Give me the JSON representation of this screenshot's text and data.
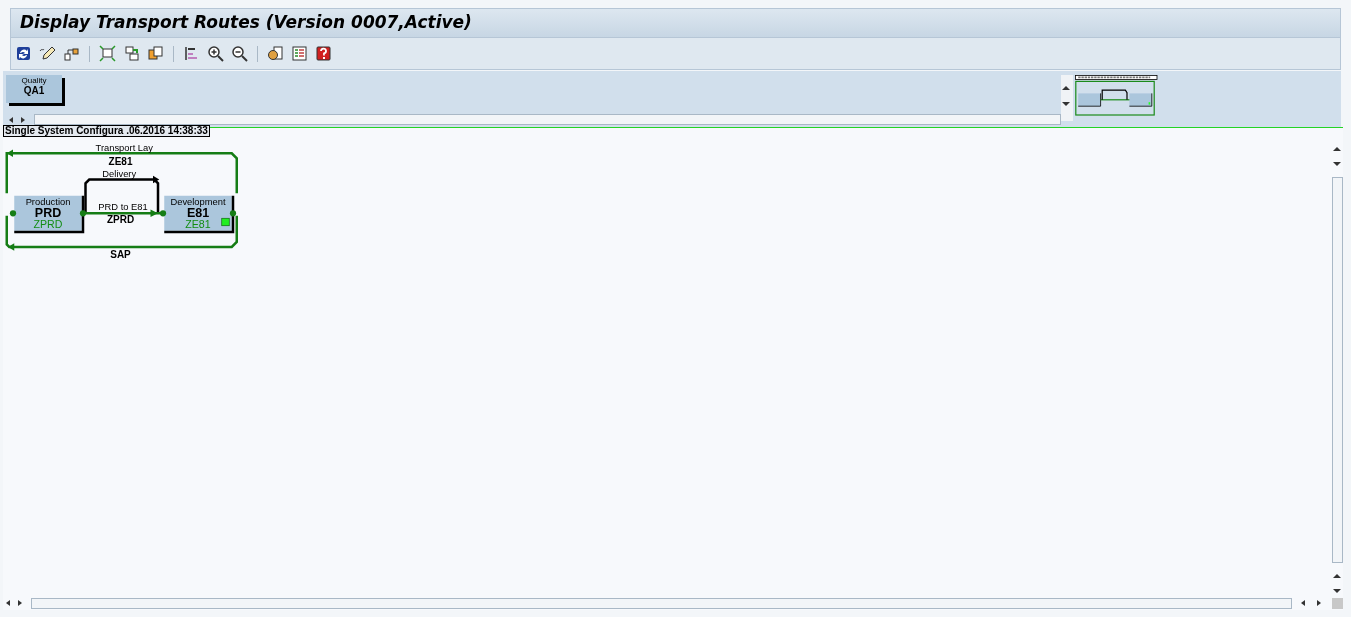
{
  "window": {
    "title": "Display Transport Routes (Version 0007,Active)"
  },
  "top_pane": {
    "systems": [
      {
        "group": "Quality",
        "sid": "QA1"
      }
    ]
  },
  "canvas": {
    "title": "Single System Configura .06.2016  14:38:33",
    "systems": [
      {
        "group": "Production",
        "sid": "PRD",
        "layer": "ZPRD",
        "marked": false
      },
      {
        "group": "Development",
        "sid": "E81",
        "layer": "ZE81",
        "marked": true
      }
    ],
    "routes": [
      {
        "kind": "loop-top",
        "caption": "Transport Lay",
        "name": "ZE81"
      },
      {
        "kind": "delivery",
        "caption": "Delivery"
      },
      {
        "kind": "consolidation",
        "caption": "PRD to E81",
        "name": "ZPRD"
      },
      {
        "kind": "loop-bottom",
        "name": "SAP"
      }
    ]
  }
}
